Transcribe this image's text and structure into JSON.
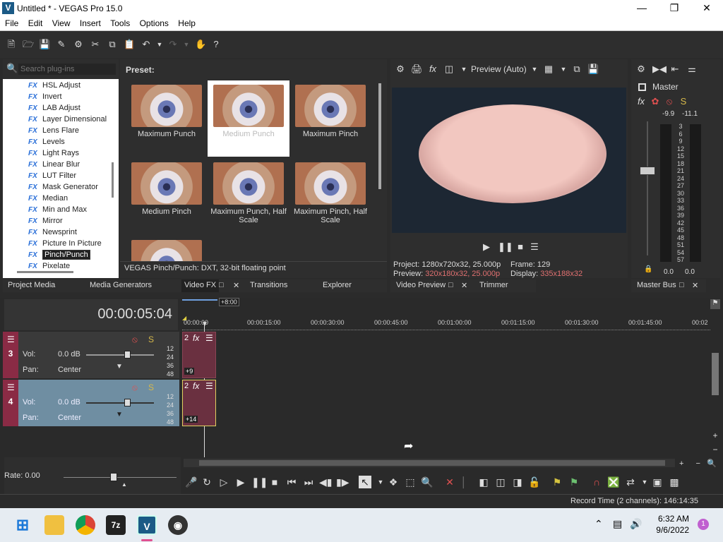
{
  "window": {
    "title": "Untitled * - VEGAS Pro 15.0",
    "logo": "V"
  },
  "menu": [
    "File",
    "Edit",
    "View",
    "Insert",
    "Tools",
    "Options",
    "Help"
  ],
  "plugins": {
    "search_placeholder": "Search plug-ins",
    "fx_badge": "FX",
    "items": [
      "HSL Adjust",
      "Invert",
      "LAB Adjust",
      "Layer Dimensional",
      "Lens Flare",
      "Levels",
      "Light Rays",
      "Linear Blur",
      "LUT Filter",
      "Mask Generator",
      "Median",
      "Min and Max",
      "Mirror",
      "Newsprint",
      "Picture In Picture",
      "Pinch/Punch",
      "Pixelate"
    ],
    "selected": "Pinch/Punch"
  },
  "presets": {
    "label": "Preset:",
    "items": [
      "Maximum Punch",
      "Medium Punch",
      "Maximum Pinch",
      "Medium Pinch",
      "Maximum Punch, Half Scale",
      "Maximum Pinch, Half Scale",
      ""
    ],
    "description": "VEGAS Pinch/Punch: DXT, 32-bit floating point"
  },
  "preview": {
    "mode": "Preview (Auto)",
    "project_label": "Project:",
    "project": "1280x720x32, 25.000p",
    "preview_label": "Preview:",
    "preview_val": "320x180x32, 25.000p",
    "frame_label": "Frame:",
    "frame": "129",
    "display_label": "Display:",
    "display": "335x188x32"
  },
  "master": {
    "label": "Master",
    "peak_left": "-9.9",
    "peak_right": "-11.1",
    "scale": [
      "3",
      "6",
      "9",
      "12",
      "15",
      "18",
      "21",
      "24",
      "27",
      "30",
      "33",
      "36",
      "39",
      "42",
      "45",
      "48",
      "51",
      "54",
      "57"
    ],
    "bottom_left": "0.0",
    "bottom_right": "0.0"
  },
  "tabs_left": [
    "Project Media",
    "Media Generators",
    "Video FX",
    "Transitions",
    "Explorer"
  ],
  "tabs_mid": [
    "Video Preview",
    "Trimmer"
  ],
  "tabs_right": [
    "Master Bus"
  ],
  "timeline": {
    "timecode": "00:00:05:04",
    "marker": "+8:00",
    "ruler": [
      "00:00:00",
      "00:00:15:00",
      "00:00:30:00",
      "00:00:45:00",
      "00:01:00:00",
      "00:01:15:00",
      "00:01:30:00",
      "00:01:45:00",
      "00:02"
    ],
    "tracks": [
      {
        "num": "3",
        "vol_label": "Vol:",
        "vol": "0.0 dB",
        "pan_label": "Pan:",
        "pan": "Center",
        "clip_num": "2",
        "clip_badge": "+9"
      },
      {
        "num": "4",
        "vol_label": "Vol:",
        "vol": "0.0 dB",
        "pan_label": "Pan:",
        "pan": "Center",
        "clip_num": "2",
        "clip_badge": "+14"
      }
    ],
    "db_marks": [
      "12",
      "24",
      "36",
      "48"
    ],
    "rate": "Rate: 0.00"
  },
  "status": {
    "record_time": "Record Time (2 channels): 146:14:35"
  },
  "taskbar": {
    "time": "6:32 AM",
    "date": "9/6/2022",
    "notif": "1",
    "zip_label": "7z",
    "vegas_label": "V"
  }
}
